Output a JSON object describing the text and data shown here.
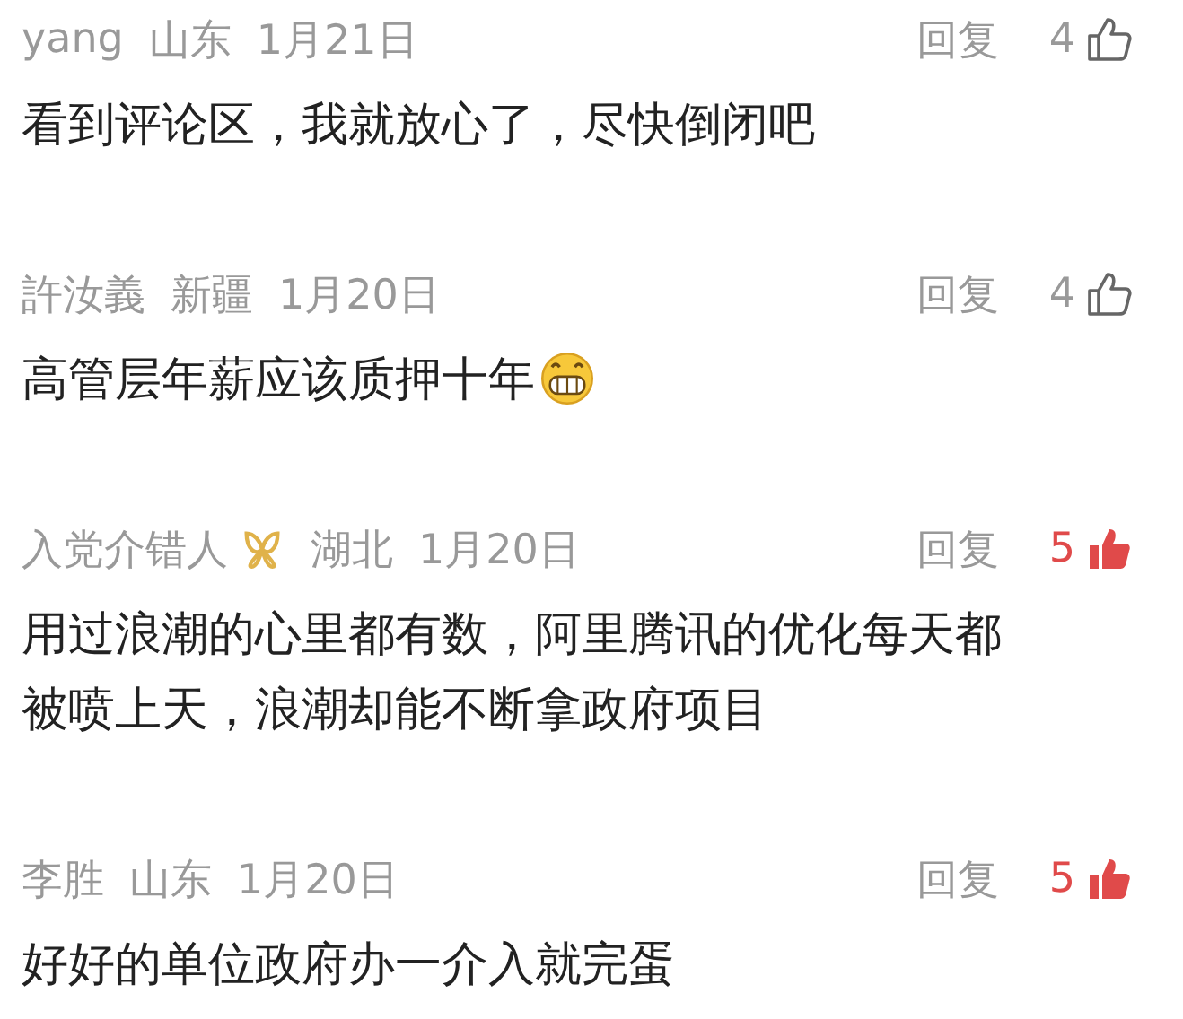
{
  "comments": [
    {
      "user": "yang",
      "badge": false,
      "region": "山东",
      "date": "1月21日",
      "reply": "回复",
      "likes": "4",
      "liked": false,
      "lines": [
        "看到评论区，我就放心了，尽快倒闭吧"
      ],
      "emoji": false
    },
    {
      "user": "許汝義",
      "badge": false,
      "region": "新疆",
      "date": "1月20日",
      "reply": "回复",
      "likes": "4",
      "liked": false,
      "lines": [
        "高管层年薪应该质押十年"
      ],
      "emoji": true
    },
    {
      "user": "入党介错人",
      "badge": true,
      "region": "湖北",
      "date": "1月20日",
      "reply": "回复",
      "likes": "5",
      "liked": true,
      "lines": [
        "用过浪潮的心里都有数，阿里腾讯的优化每天都",
        "被喷上天，浪潮却能不断拿政府项目"
      ],
      "emoji": false
    },
    {
      "user": "李胜",
      "badge": false,
      "region": "山东",
      "date": "1月20日",
      "reply": "回复",
      "likes": "5",
      "liked": true,
      "lines": [
        "好好的单位政府办一介入就完蛋"
      ],
      "emoji": false
    }
  ]
}
